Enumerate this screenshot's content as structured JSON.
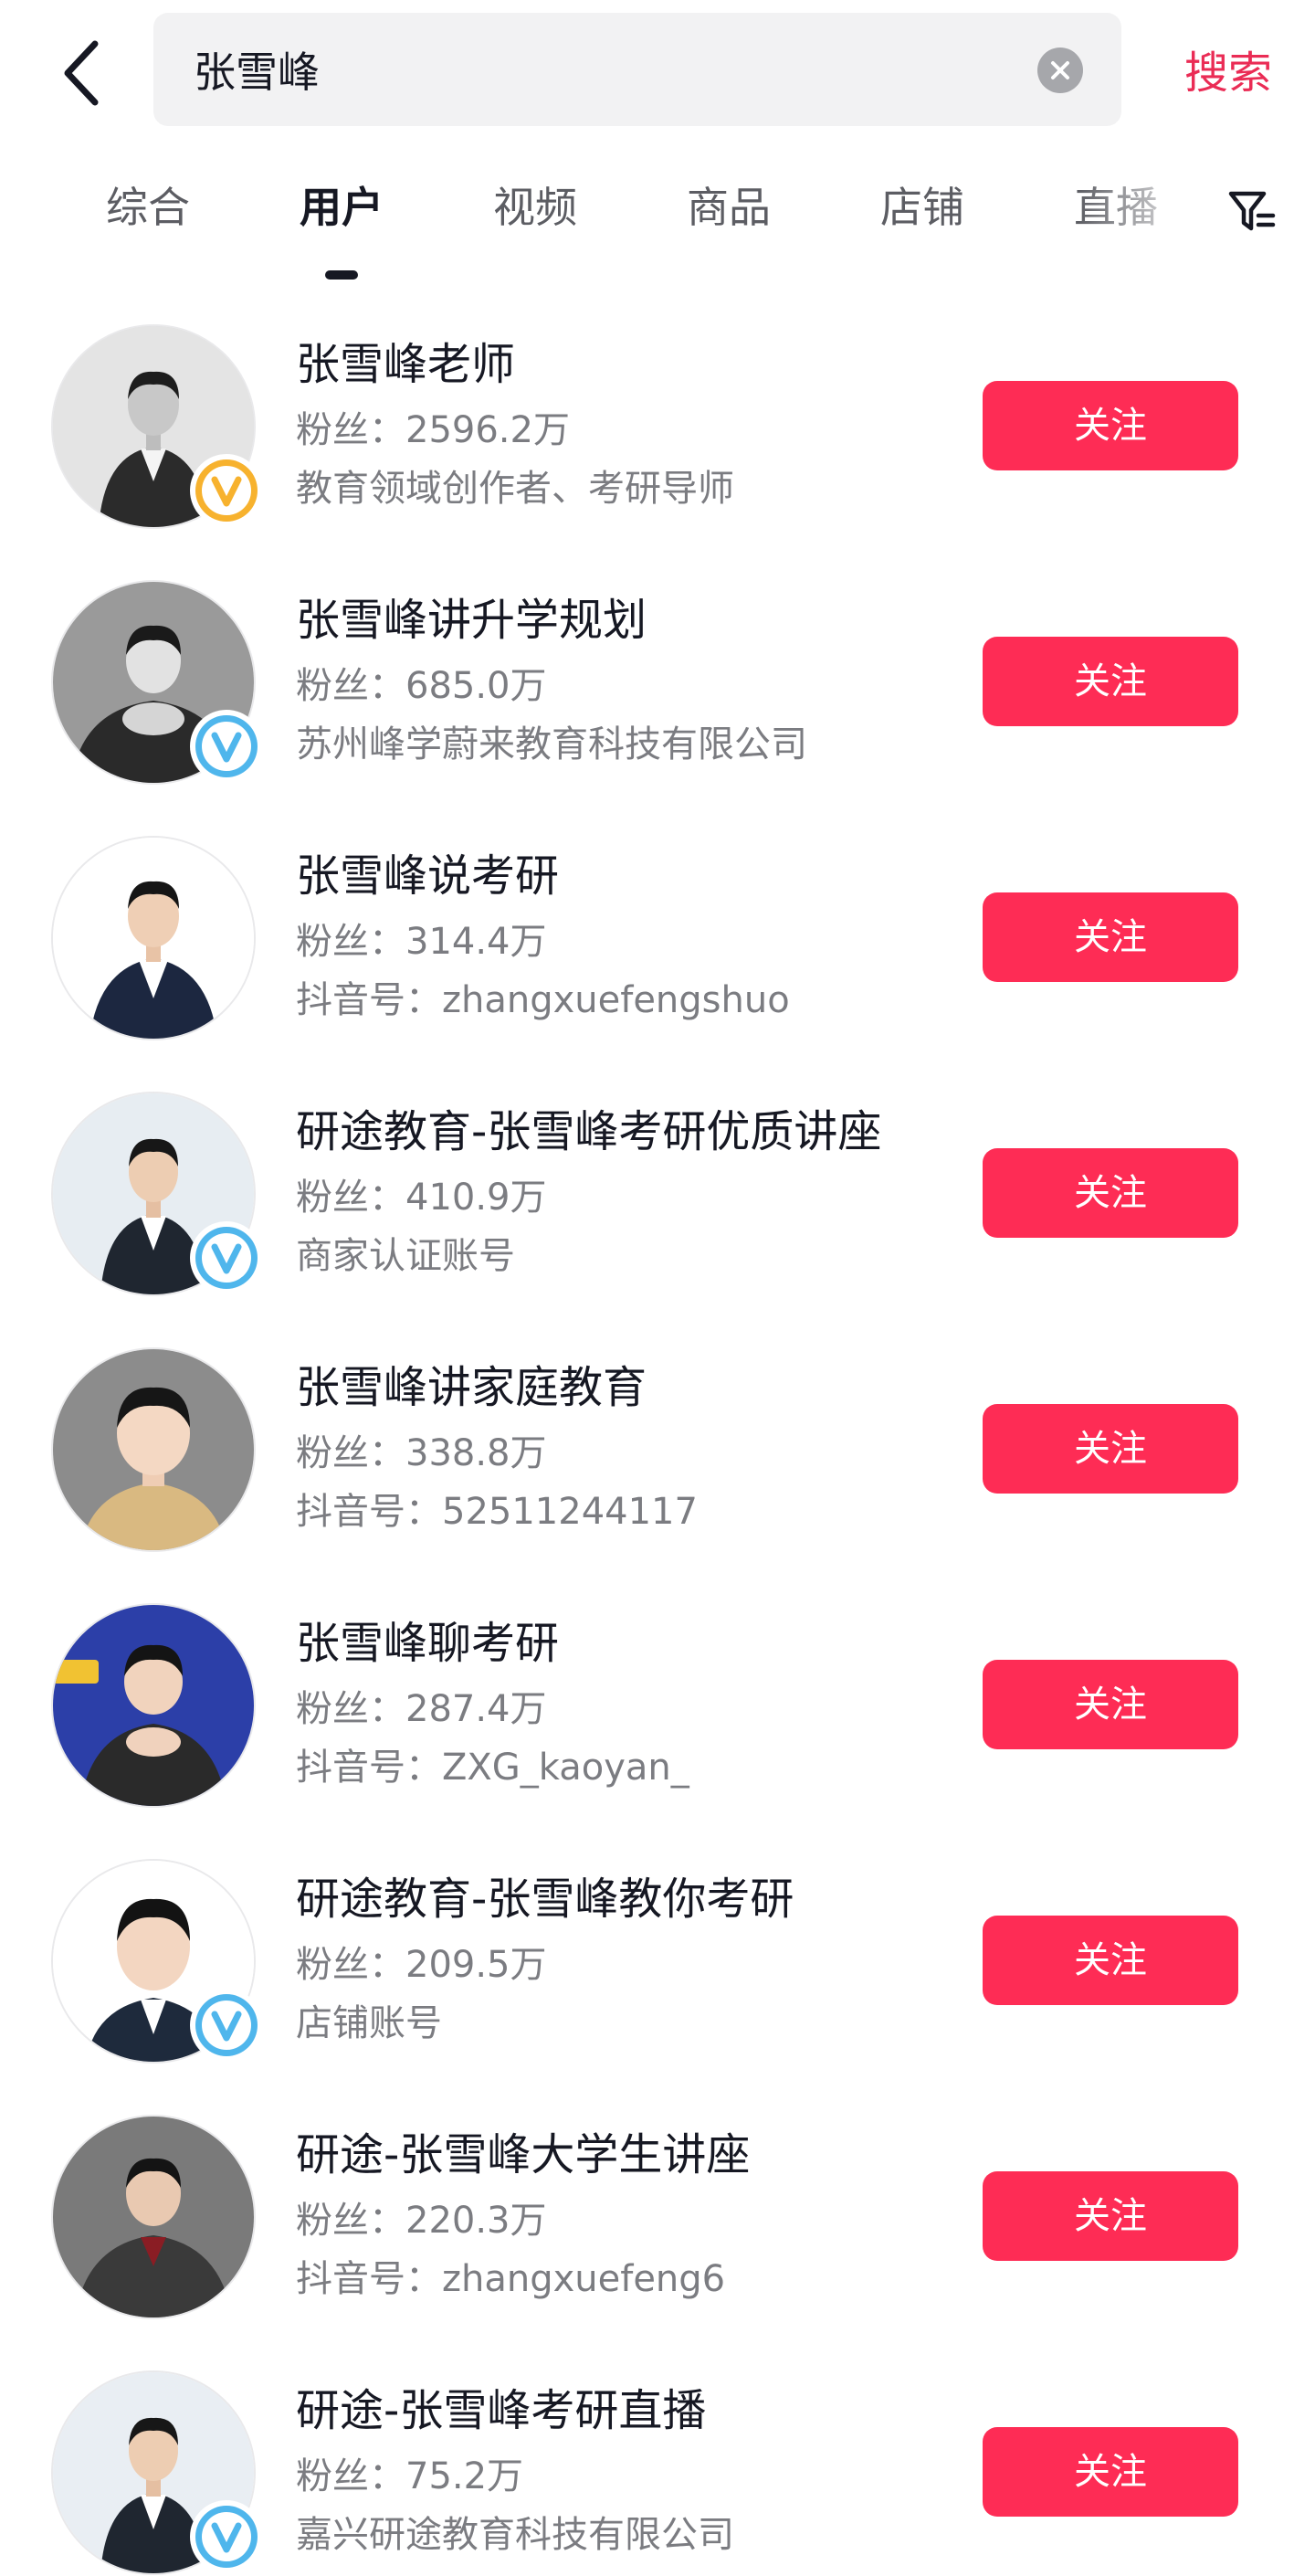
{
  "search": {
    "query": "张雪峰",
    "button_label": "搜索"
  },
  "tabs": [
    {
      "label": "综合",
      "active": false
    },
    {
      "label": "用户",
      "active": true
    },
    {
      "label": "视频",
      "active": false
    },
    {
      "label": "商品",
      "active": false
    },
    {
      "label": "店铺",
      "active": false
    },
    {
      "label": "直播",
      "active": false
    }
  ],
  "colors": {
    "accent": "#fe2c55",
    "search_text": "#ea2c55",
    "badge_gold": "#f7b22e",
    "badge_blue": "#4fb6ec"
  },
  "users": [
    {
      "name": "张雪峰老师",
      "fans": "粉丝：2596.2万",
      "sub": "教育领域创作者、考研导师",
      "badge": "gold-v-badge",
      "follow": "关注"
    },
    {
      "name": "张雪峰讲升学规划",
      "fans": "粉丝：685.0万",
      "sub": "苏州峰学蔚来教育科技有限公司",
      "badge": "blue-v-badge",
      "follow": "关注"
    },
    {
      "name": "张雪峰说考研",
      "fans": "粉丝：314.4万",
      "sub": "抖音号：zhangxuefengshuo",
      "badge": "",
      "follow": "关注"
    },
    {
      "name": "研途教育-张雪峰考研优质讲座",
      "fans": "粉丝：410.9万",
      "sub": "商家认证账号",
      "badge": "blue-v-badge",
      "follow": "关注"
    },
    {
      "name": "张雪峰讲家庭教育",
      "fans": "粉丝：338.8万",
      "sub": "抖音号：52511244117",
      "badge": "",
      "follow": "关注"
    },
    {
      "name": "张雪峰聊考研",
      "fans": "粉丝：287.4万",
      "sub": "抖音号：ZXG_kaoyan_",
      "badge": "",
      "follow": "关注"
    },
    {
      "name": "研途教育-张雪峰教你考研",
      "fans": "粉丝：209.5万",
      "sub": "店铺账号",
      "badge": "blue-v-badge",
      "follow": "关注"
    },
    {
      "name": "研途-张雪峰大学生讲座",
      "fans": "粉丝：220.3万",
      "sub": "抖音号：zhangxuefeng6",
      "badge": "",
      "follow": "关注"
    },
    {
      "name": "研途-张雪峰考研直播",
      "fans": "粉丝：75.2万",
      "sub": "嘉兴研途教育科技有限公司",
      "badge": "blue-v-badge",
      "follow": "关注"
    }
  ]
}
